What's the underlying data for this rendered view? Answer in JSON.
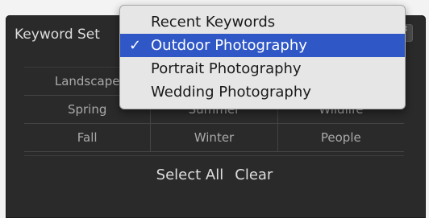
{
  "panel": {
    "set_label": "Keyword Set",
    "select_arrow_glyph": "⇕"
  },
  "menu": {
    "items": [
      {
        "label": "Recent Keywords",
        "selected": false
      },
      {
        "label": "Outdoor Photography",
        "selected": true
      },
      {
        "label": "Portrait Photography",
        "selected": false
      },
      {
        "label": "Wedding Photography",
        "selected": false
      }
    ],
    "check_glyph": "✓",
    "selected_color": "#2f57c6"
  },
  "keywords": {
    "rows": [
      [
        "Landscape",
        "",
        ""
      ],
      [
        "Spring",
        "Summer",
        "Wildlife"
      ],
      [
        "Fall",
        "Winter",
        "People"
      ]
    ]
  },
  "actions": {
    "select_all": "Select All",
    "clear": "Clear"
  }
}
